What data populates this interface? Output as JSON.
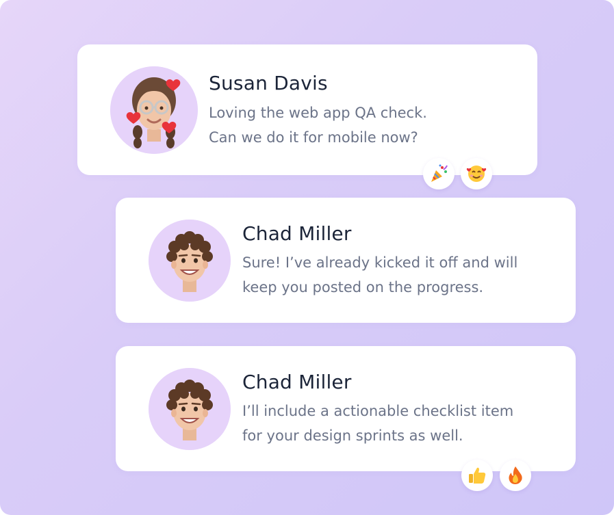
{
  "messages": [
    {
      "name": "Susan Davis",
      "lines": [
        "Loving the web app QA check.",
        "Can we do it for mobile now?"
      ],
      "reactions": [
        "party-popper-icon",
        "smiling-face-with-hearts-icon"
      ]
    },
    {
      "name": "Chad Miller",
      "lines": [
        "Sure! I’ve already kicked it off and will",
        "keep you posted on the progress."
      ],
      "reactions": []
    },
    {
      "name": "Chad Miller",
      "lines": [
        "I’ll include a actionable checklist item",
        "for your design sprints as well."
      ],
      "reactions": [
        "thumbs-up-icon",
        "fire-icon"
      ]
    }
  ],
  "colors": {
    "background_start": "#e6d6f9",
    "background_end": "#cfc6f8",
    "avatar_bg": "#e6d3fa",
    "name_text": "#1b2438",
    "message_text": "#6b7388"
  }
}
